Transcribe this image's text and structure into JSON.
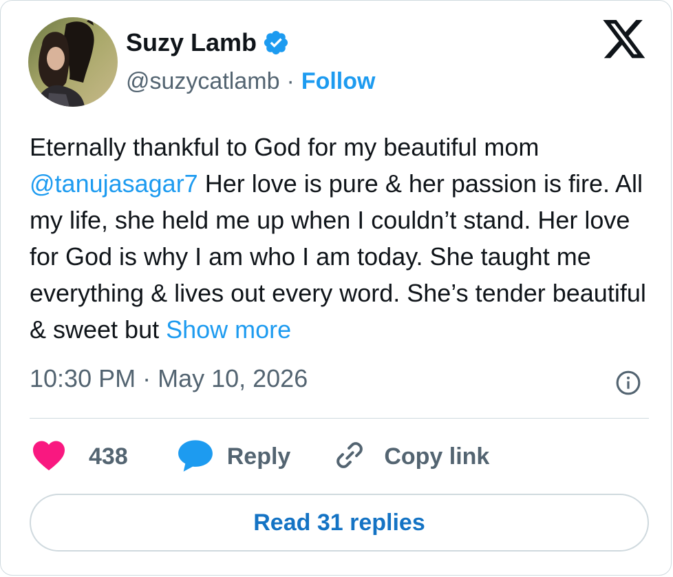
{
  "author": {
    "name": "Suzy Lamb",
    "handle": "@suzycatlamb",
    "separator": "·",
    "follow_label": "Follow",
    "verified": true,
    "verified_color": "#1d9bf0"
  },
  "tweet": {
    "text_part1": "Eternally thankful to God for my beautiful mom ",
    "mention": "@tanujasagar7",
    "text_part2": " Her love is pure & her passion is fire. All my life, she held me up when I couldn’t stand. Her love for God is why I am who I am today. She taught me everything & lives out every word. She’s tender beautiful & sweet but ",
    "show_more_label": "Show more",
    "timestamp": "10:30 PM · May 10, 2026"
  },
  "actions": {
    "like_count": "438",
    "reply_label": "Reply",
    "copy_link_label": "Copy link"
  },
  "read_replies_label": "Read 31 replies",
  "icons": {
    "platform": "x-logo-icon",
    "info": "info-icon",
    "like": "heart-icon",
    "reply": "reply-bubble-icon",
    "copy": "link-icon"
  },
  "colors": {
    "accent": "#1d9bf0",
    "like": "#f91880",
    "muted_text": "#536471",
    "text": "#0f1419"
  }
}
